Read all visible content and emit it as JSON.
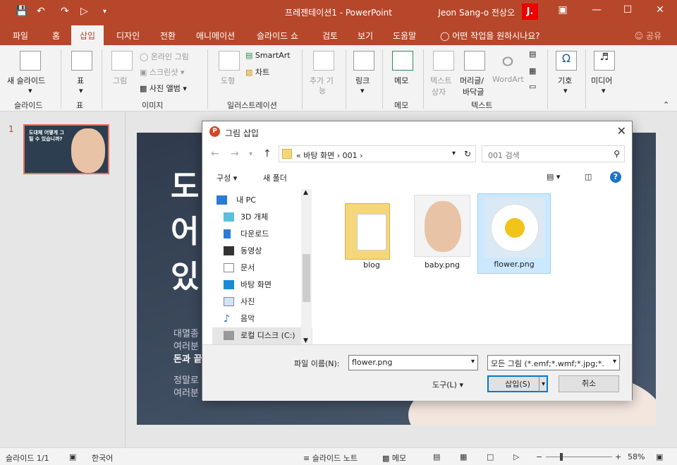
{
  "window": {
    "title": "프레젠테이션1  -  PowerPoint",
    "user_name": "Jeon Sang-o 전상오",
    "user_initial": "J."
  },
  "tabs": [
    "파일",
    "홈",
    "삽입",
    "디자인",
    "전환",
    "애니메이션",
    "슬라이드 쇼",
    "검토",
    "보기",
    "도움말"
  ],
  "tell_me": "어떤 작업을 원하시나요?",
  "share": "공유",
  "ribbon": {
    "new_slide": "새 슬라이드",
    "table": "표",
    "picture": "그림",
    "online_picture": "온라인 그림",
    "screenshot": "스크린샷",
    "photo_album": "사진 앨범",
    "shapes": "도형",
    "smartart": "SmartArt",
    "chart": "차트",
    "addins_1": "추가 기",
    "addins_2": "능",
    "link": "링크",
    "comment": "메모",
    "textbox_1": "텍스트",
    "textbox_2": "상자",
    "header_1": "머리글/",
    "header_2": "바닥글",
    "wordart": "WordArt",
    "symbols": "기호",
    "media": "미디어",
    "groups": {
      "slides": "슬라이드",
      "tables": "표",
      "images": "이미지",
      "illustrations": "일러스트레이션",
      "comments": "메모",
      "text": "텍스트"
    }
  },
  "thumb": {
    "number": "1",
    "text": "도대체 어떻게 그릴 수 있습니까?"
  },
  "slide": {
    "line1": "도",
    "line2": "어",
    "line3": "있",
    "body1": "대멸종",
    "body2": "여러분",
    "body3": "돈과 끝",
    "body4": "정말로",
    "body5": "여러분"
  },
  "dialog": {
    "title": "그림 삽입",
    "path": "«  바탕 화면  ›  001  ›",
    "search_placeholder": "001 검색",
    "organize": "구성 ▾",
    "new_folder": "새 폴더",
    "tree": [
      "내 PC",
      "3D 개체",
      "다운로드",
      "동영상",
      "문서",
      "바탕 화면",
      "사진",
      "음악",
      "로컬 디스크 (C:)"
    ],
    "files": [
      "blog",
      "baby.png",
      "flower.png"
    ],
    "filename_label": "파일 이름(N):",
    "filename_value": "flower.png",
    "filetype": "모든 그림 (*.emf;*.wmf;*.jpg;*.",
    "tools": "도구(L)",
    "insert": "삽입(S)",
    "cancel": "취소"
  },
  "status": {
    "slide_info": "슬라이드 1/1",
    "language": "한국어",
    "notes": "슬라이드 노트",
    "comments": "메모",
    "zoom": "58%"
  }
}
